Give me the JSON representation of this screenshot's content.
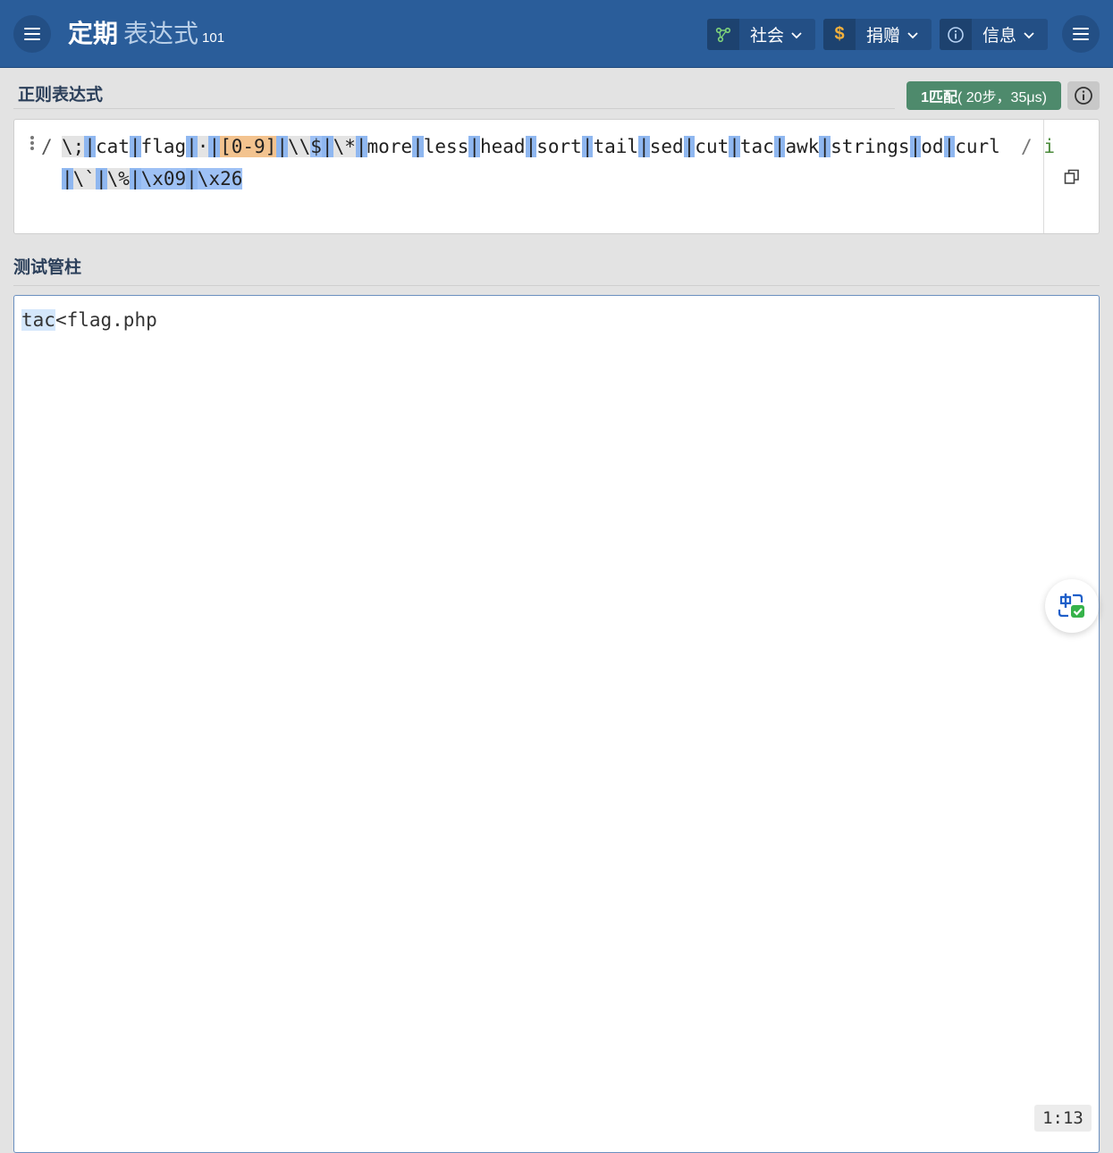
{
  "header": {
    "title_main": "定期",
    "title_sub": "表达式",
    "title_version": "101",
    "menus": [
      {
        "label": "社会",
        "icon": "share-graph-icon"
      },
      {
        "label": "捐赠",
        "icon": "dollar-icon"
      },
      {
        "label": "信息",
        "icon": "info-icon"
      }
    ]
  },
  "regex_section": {
    "title": "正则表达式",
    "match_count": "1匹配",
    "match_detail": "( 20步，35μs)",
    "delimiter_open": "/",
    "delimiter_close": "/",
    "flags": "i"
  },
  "regex_tokens": [
    {
      "t": "\\;",
      "c": "esc"
    },
    {
      "t": "|",
      "c": "bar"
    },
    {
      "t": "cat",
      "c": ""
    },
    {
      "t": "|",
      "c": "bar"
    },
    {
      "t": "flag",
      "c": ""
    },
    {
      "t": "|",
      "c": "bar"
    },
    {
      "t": "·",
      "c": "esc"
    },
    {
      "t": "|",
      "c": "bar"
    },
    {
      "t": "[0-9]",
      "c": "cls"
    },
    {
      "t": "|",
      "c": "bar"
    },
    {
      "t": "\\\\",
      "c": "esc"
    },
    {
      "t": "$",
      "c": "hl"
    },
    {
      "t": "|",
      "c": "bar"
    },
    {
      "t": "\\*",
      "c": "esc"
    },
    {
      "t": "|",
      "c": "bar"
    },
    {
      "t": "more",
      "c": ""
    },
    {
      "t": "|",
      "c": "bar"
    },
    {
      "t": "less",
      "c": ""
    },
    {
      "t": "|",
      "c": "bar"
    },
    {
      "t": "head",
      "c": ""
    },
    {
      "t": "|",
      "c": "bar"
    },
    {
      "t": "sort",
      "c": ""
    },
    {
      "t": "|",
      "c": "bar"
    },
    {
      "t": "tail",
      "c": ""
    },
    {
      "t": "|",
      "c": "bar"
    },
    {
      "t": "sed",
      "c": ""
    },
    {
      "t": "|",
      "c": "bar"
    },
    {
      "t": "cut",
      "c": ""
    },
    {
      "t": "|",
      "c": "bar"
    },
    {
      "t": "tac",
      "c": ""
    },
    {
      "t": "|",
      "c": "bar"
    },
    {
      "t": "awk",
      "c": ""
    },
    {
      "t": "|",
      "c": "bar"
    },
    {
      "t": "strings",
      "c": ""
    },
    {
      "t": "|",
      "c": "bar"
    },
    {
      "t": "od",
      "c": ""
    },
    {
      "t": "|",
      "c": "bar"
    },
    {
      "t": "curl",
      "c": ""
    },
    {
      "t": "|",
      "c": "bar"
    },
    {
      "t": "\\`",
      "c": "esc"
    },
    {
      "t": "|",
      "c": "bar"
    },
    {
      "t": "\\%",
      "c": "esc"
    },
    {
      "t": "|",
      "c": "bar"
    },
    {
      "t": "\\x09",
      "c": "hl"
    },
    {
      "t": "|",
      "c": "bar"
    },
    {
      "t": "\\x26",
      "c": "hl"
    }
  ],
  "test_section": {
    "title": "测试管柱",
    "match": "tac",
    "rest": "<flag.php",
    "cursor_position": "1:13"
  },
  "colors": {
    "header_bg": "#2a5d9a",
    "match_badge": "#4e8a6c"
  }
}
